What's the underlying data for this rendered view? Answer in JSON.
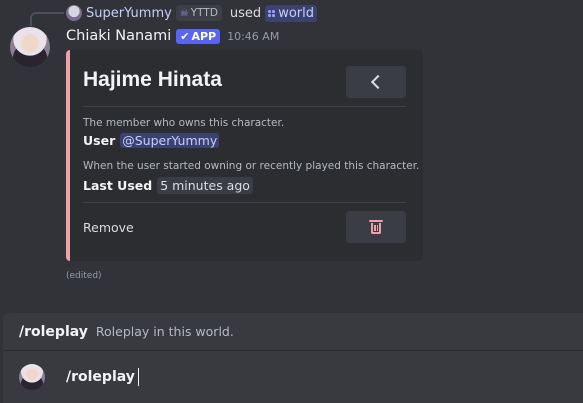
{
  "reply": {
    "user": "SuperYummy",
    "tag": "YTTD",
    "used_text": "used",
    "command": "world"
  },
  "message": {
    "author": "Chiaki Nanami",
    "badge": "APP",
    "timestamp": "10:46 AM",
    "edited": "(edited)"
  },
  "embed": {
    "title": "Hajime Hinata",
    "accent_color": "#f0a0a8",
    "fields": [
      {
        "description": "The member who owns this character.",
        "name": "User",
        "value": "@SuperYummy"
      },
      {
        "description": "When the user started owning or recently played this character.",
        "name": "Last Used",
        "value": "5 minutes ago"
      }
    ],
    "remove_label": "Remove",
    "back_icon": "chevron-left-icon",
    "delete_icon": "trash-icon"
  },
  "composer": {
    "suggestion_command": "/roleplay",
    "suggestion_description": "Roleplay in this world.",
    "input_value": "/roleplay"
  }
}
